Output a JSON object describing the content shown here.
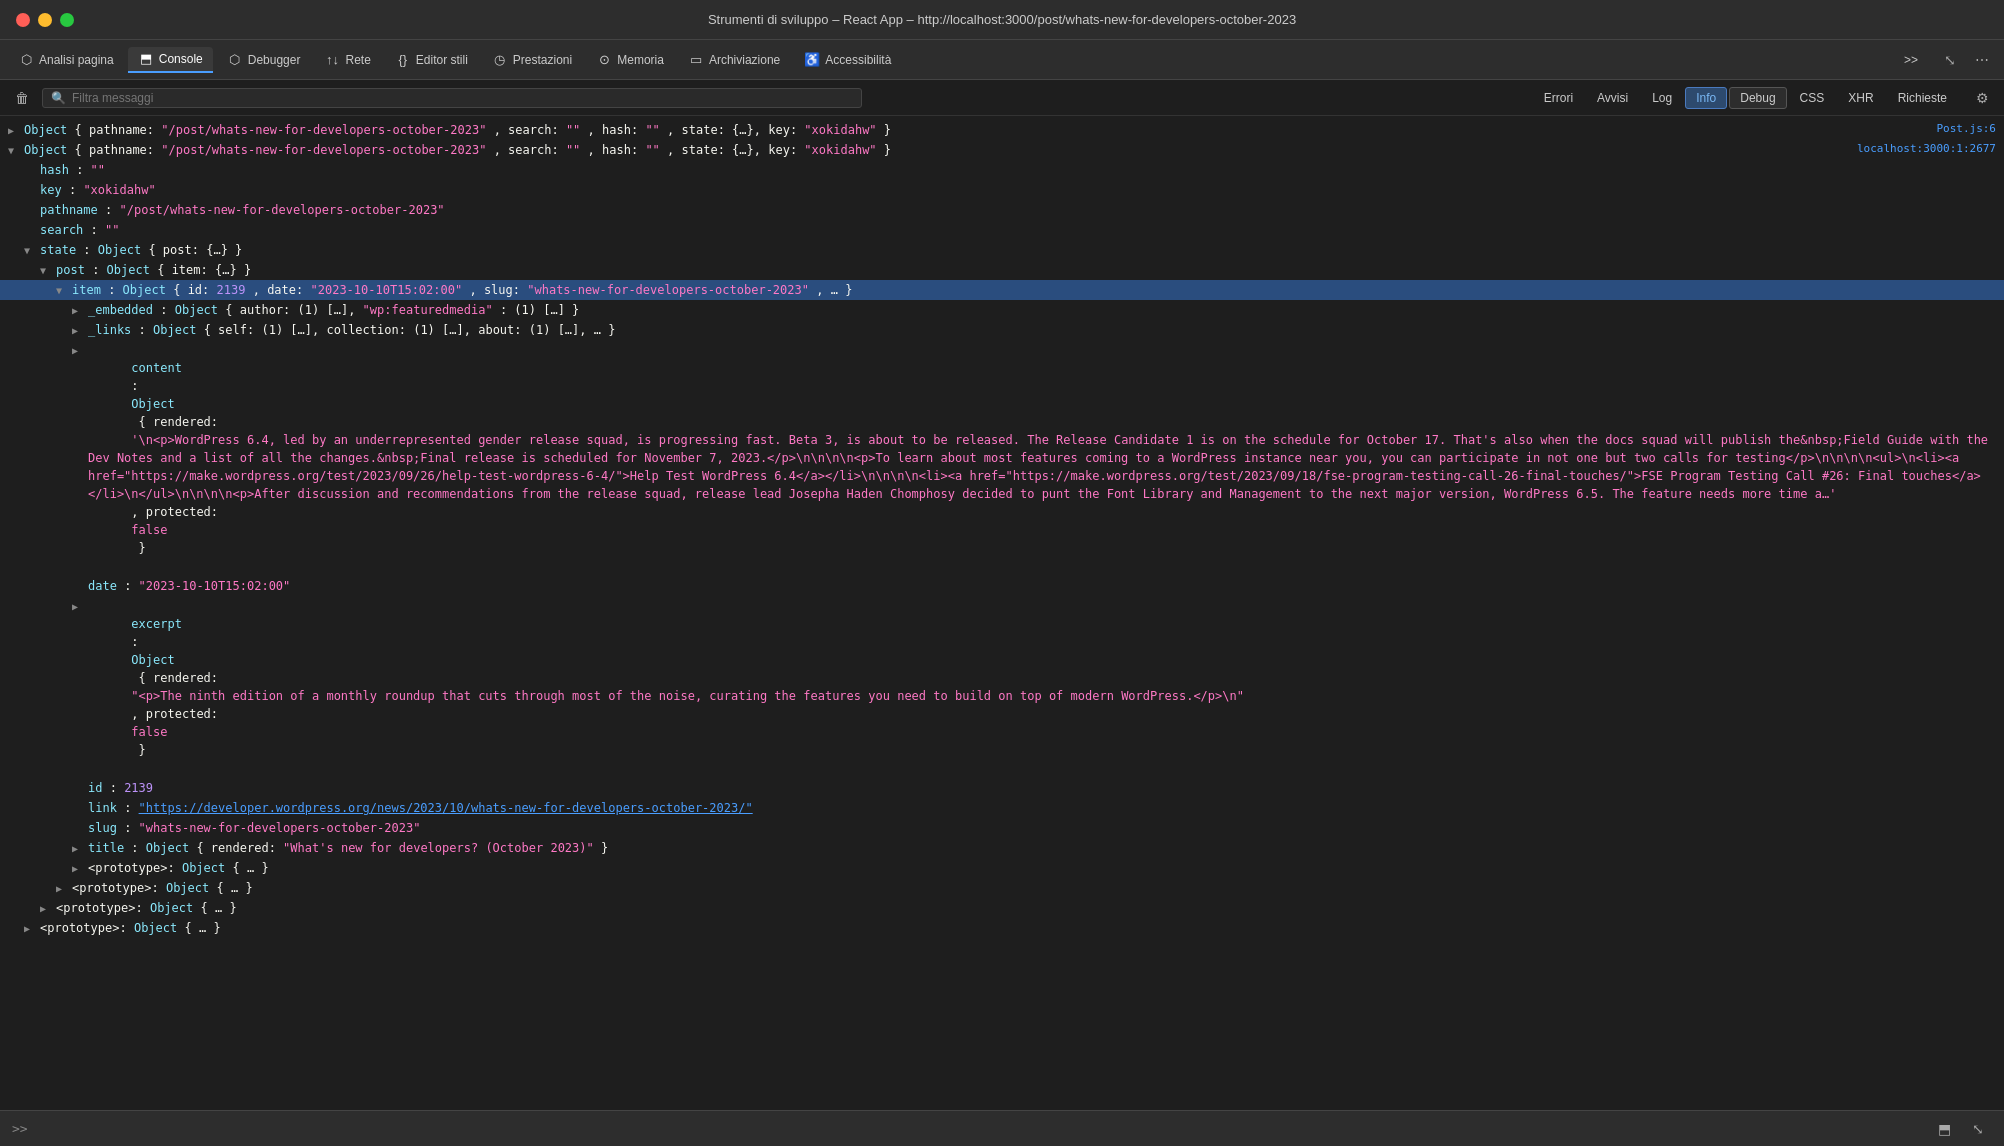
{
  "title_bar": {
    "title": "Strumenti di sviluppo – React App – http://localhost:3000/post/whats-new-for-developers-october-2023"
  },
  "toolbar": {
    "buttons": [
      {
        "id": "analisi",
        "label": "Analisi pagina",
        "icon": "⬡",
        "active": false
      },
      {
        "id": "console",
        "label": "Console",
        "icon": "⬒",
        "active": true
      },
      {
        "id": "debugger",
        "label": "Debugger",
        "icon": "⬡",
        "active": false
      },
      {
        "id": "rete",
        "label": "Rete",
        "icon": "↑↓",
        "active": false
      },
      {
        "id": "editor",
        "label": "Editor stili",
        "icon": "{}",
        "active": false
      },
      {
        "id": "prestazioni",
        "label": "Prestazioni",
        "icon": "◷",
        "active": false
      },
      {
        "id": "memoria",
        "label": "Memoria",
        "icon": "⊙",
        "active": false
      },
      {
        "id": "archiviazione",
        "label": "Archiviazione",
        "icon": "▭",
        "active": false
      },
      {
        "id": "accessibilita",
        "label": "Accessibilità",
        "icon": "♿",
        "active": false
      }
    ],
    "more_label": ">>",
    "expand_label": "⤡",
    "menu_label": "⋯"
  },
  "filter_bar": {
    "trash_label": "🗑",
    "filter_placeholder": "Filtra messaggi",
    "buttons": [
      {
        "id": "errori",
        "label": "Errori",
        "active": false
      },
      {
        "id": "avvisi",
        "label": "Avvisi",
        "active": false
      },
      {
        "id": "log",
        "label": "Log",
        "active": false
      },
      {
        "id": "info",
        "label": "Info",
        "active": true
      },
      {
        "id": "debug",
        "label": "Debug",
        "active": false
      },
      {
        "id": "css",
        "label": "CSS",
        "active": false
      },
      {
        "id": "xhr",
        "label": "XHR",
        "active": false
      },
      {
        "id": "richieste",
        "label": "Richieste",
        "active": false
      }
    ],
    "settings_label": "⚙"
  },
  "console": {
    "rows": [
      {
        "id": "row1",
        "indent": 0,
        "arrow": "collapsed",
        "selected": false,
        "source": "Post.js:6",
        "content": "Object { pathname: \"/post/whats-new-for-developers-october-2023\", search: \"\", hash: \"\", state: {…}, key: \"xokidahw\" }"
      },
      {
        "id": "row2",
        "indent": 0,
        "arrow": "expanded",
        "selected": false,
        "source": "localhost:3000:1:2677",
        "content": "Object { pathname: \"/post/whats-new-for-developers-october-2023\", search: \"\", hash: \"\", state: {…}, key: \"xokidahw\" }"
      },
      {
        "id": "row3",
        "indent": 1,
        "arrow": "none",
        "selected": false,
        "source": "",
        "content_parts": [
          {
            "text": "hash: ",
            "cls": "key-color"
          },
          {
            "text": "\"\"",
            "cls": "str-color"
          }
        ]
      },
      {
        "id": "row4",
        "indent": 1,
        "arrow": "none",
        "selected": false,
        "source": "",
        "content_parts": [
          {
            "text": "key: ",
            "cls": "key-color"
          },
          {
            "text": "\"xokidahw\"",
            "cls": "str-color"
          }
        ]
      },
      {
        "id": "row5",
        "indent": 1,
        "arrow": "none",
        "selected": false,
        "source": "",
        "content_parts": [
          {
            "text": "pathname: ",
            "cls": "key-color"
          },
          {
            "text": "\"/post/whats-new-for-developers-october-2023\"",
            "cls": "str-color"
          }
        ]
      },
      {
        "id": "row6",
        "indent": 1,
        "arrow": "none",
        "selected": false,
        "source": "",
        "content_parts": [
          {
            "text": "search: ",
            "cls": "key-color"
          },
          {
            "text": "\"\"",
            "cls": "str-color"
          }
        ]
      },
      {
        "id": "row7",
        "indent": 1,
        "arrow": "expanded",
        "selected": false,
        "source": "",
        "content": "state: Object { post: {…} }"
      },
      {
        "id": "row8",
        "indent": 2,
        "arrow": "expanded",
        "selected": false,
        "source": "",
        "content": "post: Object { item: {…} }"
      },
      {
        "id": "row9",
        "indent": 3,
        "arrow": "expanded",
        "selected": true,
        "source": "",
        "content": "item: Object { id: 2139, date: \"2023-10-10T15:02:00\", slug: \"whats-new-for-developers-october-2023\", … }"
      },
      {
        "id": "row10",
        "indent": 4,
        "arrow": "collapsed",
        "selected": false,
        "source": "",
        "content": "_embedded: Object { author: (1) […], \"wp:featuredmedia\": (1) […] }"
      },
      {
        "id": "row11",
        "indent": 4,
        "arrow": "collapsed",
        "selected": false,
        "source": "",
        "content": "_links: Object { self: (1) […], collection: (1) […], about: (1) […], … }"
      },
      {
        "id": "row12",
        "indent": 4,
        "arrow": "collapsed",
        "selected": false,
        "source": "",
        "content": "content: Object { rendered: '\\n<p>WordPress 6.4, led by an underrepresented gender release squad, is progressing fast. Beta 3, is about to be released. The Release Candidate 1 is on the schedule for October 17. That's also when the docs squad will publish the&nbsp;Field Guide with the Dev Notes and a list of all the changes.&nbsp;Final release is scheduled for November 7, 2023.</p>\\n\\n\\n\\n<p>To learn about most features coming to a WordPress instance near you, you can participate in not one but two calls for testing</p>\\n\\n\\n\\n<ul>\\n<li><a href=\"https://make.wordpress.org/test/2023/09/26/help-test-wordpress-6-4/\">Help Test WordPress 6.4</a></li>\\n\\n\\n\\n<li><a href=\"https://make.wordpress.org/test/2023/09/18/fse-program-testing-call-26-final-touches/\">FSE Program Testing Call #26: Final touches</a></li>\\n</ul>\\n\\n\\n\\n<p>After discussion and recommendations from the release squad, release lead Josepha Haden Chomphosy decided to punt the Font Library and Management to the next major version, WordPress 6.5. The feature needs more time a…', protected: false }"
      },
      {
        "id": "row13",
        "indent": 4,
        "arrow": "none",
        "selected": false,
        "source": "",
        "content_parts": [
          {
            "text": "date: ",
            "cls": "key-color"
          },
          {
            "text": "\"2023-10-10T15:02:00\"",
            "cls": "str-color"
          }
        ]
      },
      {
        "id": "row14",
        "indent": 4,
        "arrow": "collapsed",
        "selected": false,
        "source": "",
        "content": "excerpt: Object { rendered: \"<p>The ninth edition of a monthly roundup that cuts through most of the noise, curating the features you need to build on top of modern WordPress.</p>\\n\", protected: false }"
      },
      {
        "id": "row15",
        "indent": 4,
        "arrow": "none",
        "selected": false,
        "source": "",
        "content_parts": [
          {
            "text": "id: ",
            "cls": "key-color"
          },
          {
            "text": "2139",
            "cls": "num-color"
          }
        ]
      },
      {
        "id": "row16",
        "indent": 4,
        "arrow": "none",
        "selected": false,
        "source": "",
        "content_parts": [
          {
            "text": "link: ",
            "cls": "key-color"
          },
          {
            "text": "\"https://developer.wordpress.org/news/2023/10/whats-new-for-developers-october-2023/\"",
            "cls": "c-link"
          }
        ]
      },
      {
        "id": "row17",
        "indent": 4,
        "arrow": "none",
        "selected": false,
        "source": "",
        "content_parts": [
          {
            "text": "slug: ",
            "cls": "key-color"
          },
          {
            "text": "\"whats-new-for-developers-october-2023\"",
            "cls": "str-color"
          }
        ]
      },
      {
        "id": "row18",
        "indent": 4,
        "arrow": "collapsed",
        "selected": false,
        "source": "",
        "content": "title: Object { rendered: \"What's new for developers? (October 2023)\" }"
      },
      {
        "id": "row19",
        "indent": 4,
        "arrow": "collapsed",
        "selected": false,
        "source": "",
        "content": "<prototype>: Object { … }"
      },
      {
        "id": "row20",
        "indent": 3,
        "arrow": "collapsed",
        "selected": false,
        "source": "",
        "content": "<prototype>: Object { … }"
      },
      {
        "id": "row21",
        "indent": 2,
        "arrow": "collapsed",
        "selected": false,
        "source": "",
        "content": "<prototype>: Object { … }"
      },
      {
        "id": "row22",
        "indent": 1,
        "arrow": "collapsed",
        "selected": false,
        "source": "",
        "content": "<prototype>: Object { … }"
      }
    ]
  },
  "bottom_bar": {
    "prompt": ">>",
    "console_icon": "⬒",
    "resize_icon": "⤡"
  },
  "colors": {
    "selected_bg": "#2a4d7e",
    "active_tab_border": "#4a9eff",
    "info_active_bg": "#2d4a6e",
    "info_active_color": "#7ab8f5"
  }
}
